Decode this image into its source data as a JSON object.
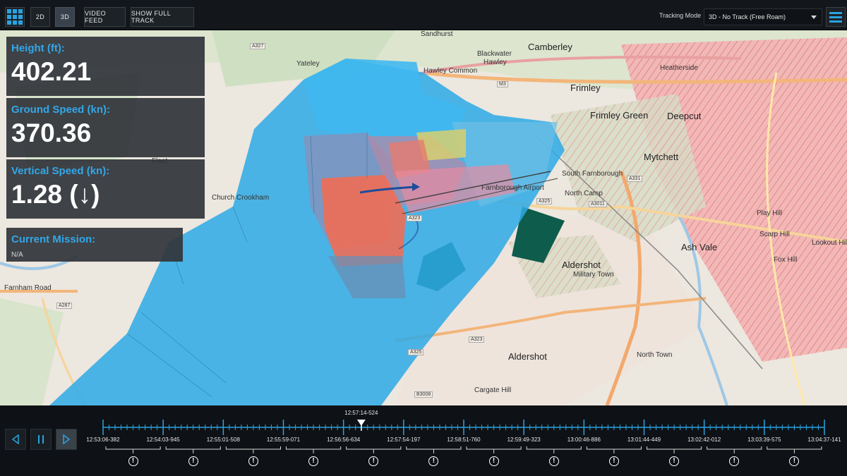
{
  "toolbar": {
    "view_2d": "2D",
    "view_3d": "3D",
    "video_feed": "VIDEO FEED",
    "show_full_track": "SHOW FULL TRACK",
    "tracking_mode_label": "Tracking Mode",
    "tracking_mode_value": "3D - No Track (Free Roam)",
    "accent_color": "#2aa3e0"
  },
  "panels": {
    "height": {
      "label": "Height (ft):",
      "value": "402.21"
    },
    "ground_speed": {
      "label": "Ground Speed (kn):",
      "value": "370.36"
    },
    "vertical_speed": {
      "label": "Vertical Speed (kn):",
      "value": "1.28 (↓)"
    },
    "mission": {
      "label": "Current Mission:",
      "value": "N/A"
    }
  },
  "map": {
    "labels": [
      "Sandhurst",
      "Camberley",
      "Blackwater",
      "Yateley",
      "Hawley",
      "Hawley Common",
      "Frimley",
      "Frimley Green",
      "Deepcut",
      "Heatherside",
      "Mytchett",
      "South Farnborough",
      "North Camp",
      "Aldershot",
      "Military Town",
      "Ash Vale",
      "Aldershot",
      "North Town",
      "Fox Hill",
      "Play Hill",
      "Scarp Hill",
      "Lookout Hill",
      "Church Crookham",
      "Fleet",
      "Farnham Road",
      "Cargate Hill",
      "Farnborough Airport"
    ],
    "roads": [
      "A327",
      "M3",
      "A287",
      "A325",
      "A3011",
      "A323",
      "A331",
      "A325",
      "B3008",
      "A323"
    ]
  },
  "timeline": {
    "current_marker": "12:57:14-524",
    "progress": 0.358,
    "ticks": [
      "12:53:06-382",
      "12:54:03-945",
      "12:55:01-508",
      "12:55:59-071",
      "12:56:56-634",
      "12:57:54-197",
      "12:58:51-760",
      "12:59:49-323",
      "13:00:46-886",
      "13:01:44-449",
      "13:02:42-012",
      "13:03:39-575",
      "13:04:37-141"
    ],
    "warning_glyph": "!"
  }
}
